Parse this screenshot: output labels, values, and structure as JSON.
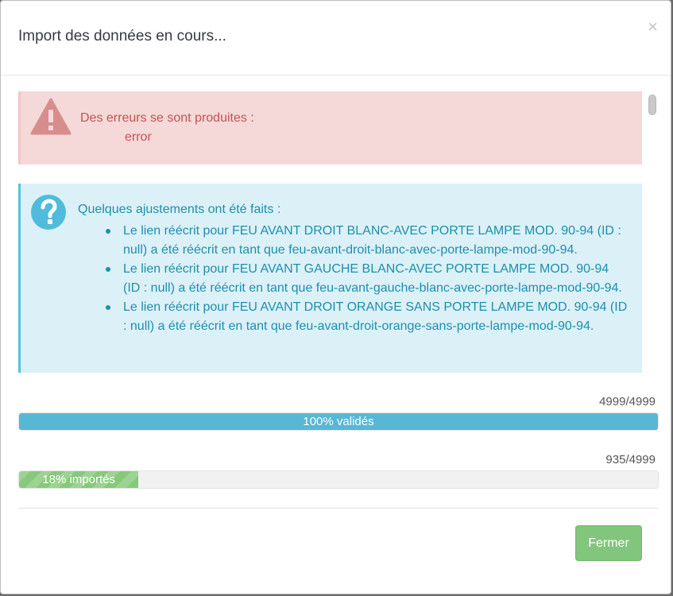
{
  "modal": {
    "title": "Import des données en cours...",
    "close_glyph": "×"
  },
  "alerts": {
    "danger": {
      "title": "Des erreurs se sont produites :",
      "items": [
        "error"
      ]
    },
    "info": {
      "title": "Quelques ajustements ont été faits :",
      "items": [
        "Le lien réécrit pour FEU AVANT DROIT BLANC-AVEC PORTE LAMPE MOD. 90-94 (ID : null) a été réécrit en tant que feu-avant-droit-blanc-avec-porte-lampe-mod-90-94.",
        "Le lien réécrit pour FEU AVANT GAUCHE BLANC-AVEC PORTE LAMPE MOD. 90-94 (ID : null) a été réécrit en tant que feu-avant-gauche-blanc-avec-porte-lampe-mod-90-94.",
        "Le lien réécrit pour FEU AVANT DROIT ORANGE SANS PORTE LAMPE MOD. 90-94 (ID : null) a été réécrit en tant que feu-avant-droit-orange-sans-porte-lampe-mod-90-94."
      ]
    }
  },
  "progress": {
    "validation": {
      "count": "4999/4999",
      "label": "100% validés",
      "fraction": 1.0
    },
    "import": {
      "count": "935/4999",
      "label": "18% importés",
      "fraction": 0.187
    }
  },
  "footer": {
    "close_label": "Fermer"
  },
  "colors": {
    "danger_text": "#c45353",
    "info_text": "#1e8fae",
    "validation_fill": "#59b7d6",
    "import_fill": "#86c97a",
    "button": "#82c57c"
  },
  "icons": {
    "danger": "warning-triangle-icon",
    "info": "question-circle-icon",
    "close": "close-icon"
  }
}
